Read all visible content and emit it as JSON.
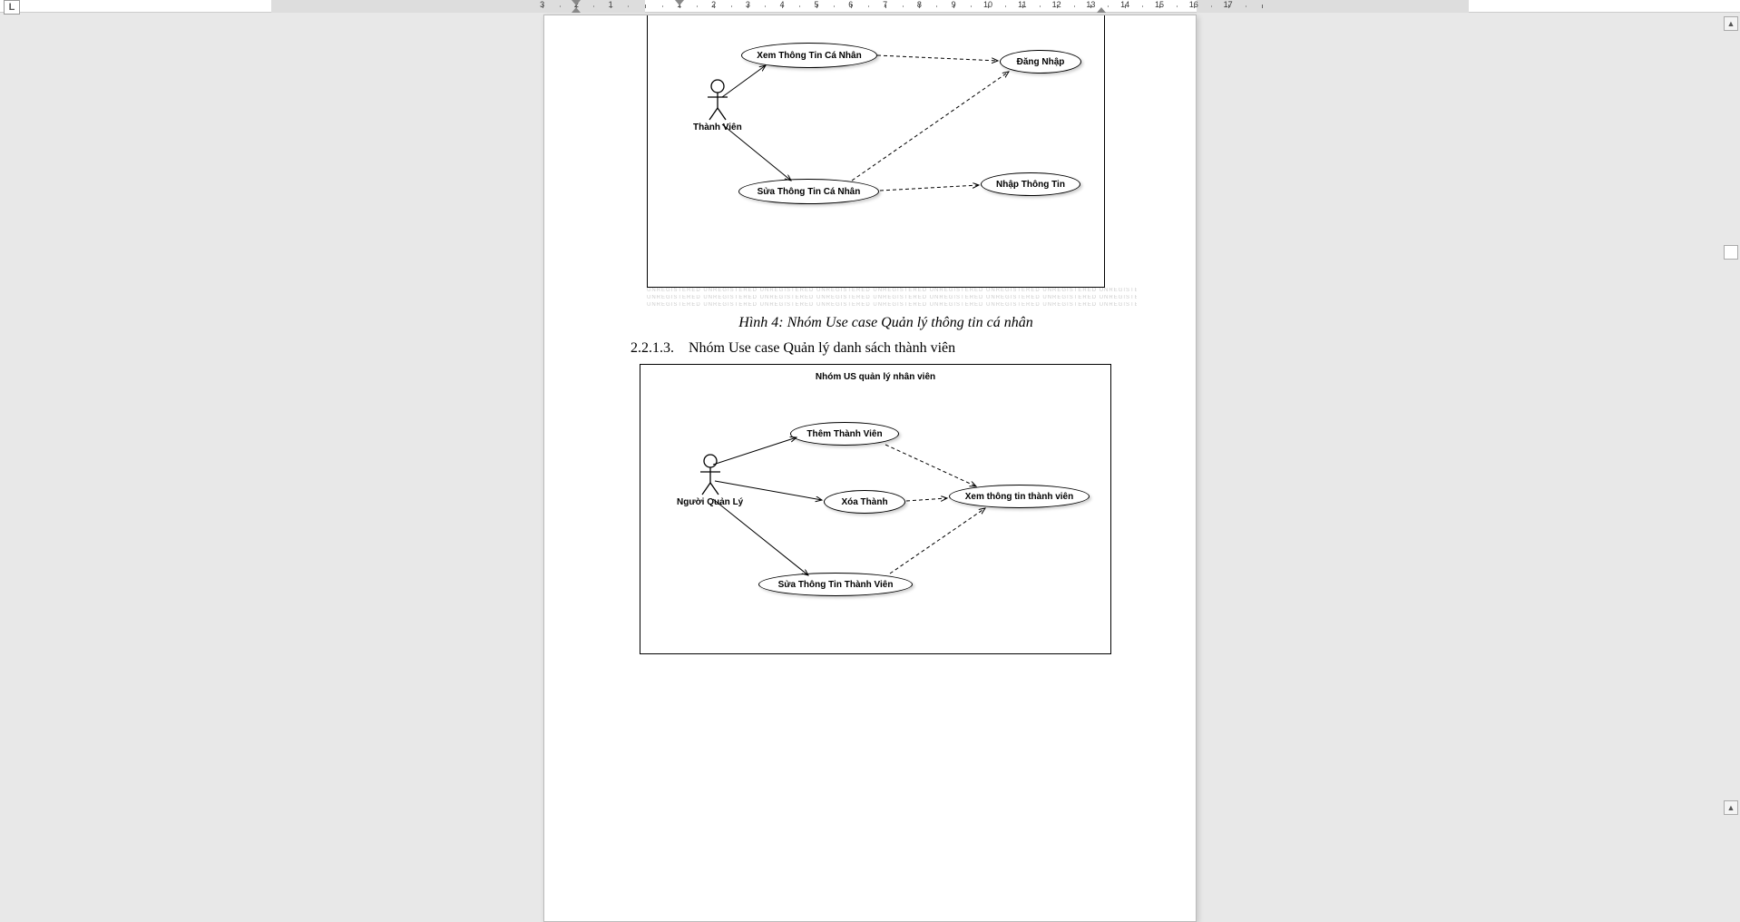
{
  "tab_indicator": "L",
  "ruler": {
    "left_numbers": [
      3,
      2,
      1
    ],
    "right_numbers": [
      1,
      2,
      3,
      4,
      5,
      6,
      7,
      8,
      9,
      10,
      11,
      12,
      13,
      14,
      15,
      16,
      17
    ]
  },
  "watermark_text": "UNREGISTERED  UNREGISTERED  UNREGISTERED  UNREGISTERED  UNREGISTERED  UNREGISTERED  UNREGISTERED  UNREGISTERED  UNREGISTERED  UNREGISTERED  UNREGISTERED  UNREGISTERED",
  "watermark_side": "UNREG",
  "diagram1": {
    "actor_label": "Thành Viên",
    "uc_view_info": "Xem Thông Tin Cá Nhân",
    "uc_login": "Đăng Nhập",
    "uc_edit_info": "Sửa Thông Tin Cá Nhân",
    "uc_input_info": "Nhập Thông Tin"
  },
  "caption1": "Hình 4: Nhóm Use case Quản lý thông tin cá nhân",
  "section_number": "2.2.1.3.",
  "section_title": "Nhóm Use case Quản lý danh sách thành viên",
  "diagram2": {
    "title": "Nhóm US quản lý nhân viên",
    "actor_label": "Người Quản Lý",
    "uc_add_member": "Thêm Thành Viên",
    "uc_delete_member": "Xóa Thành",
    "uc_view_member_info": "Xem thông tin thành viên",
    "uc_edit_member": "Sửa Thông Tin Thành Viên"
  },
  "scroll": {
    "up": "▲",
    "down": "▲"
  }
}
